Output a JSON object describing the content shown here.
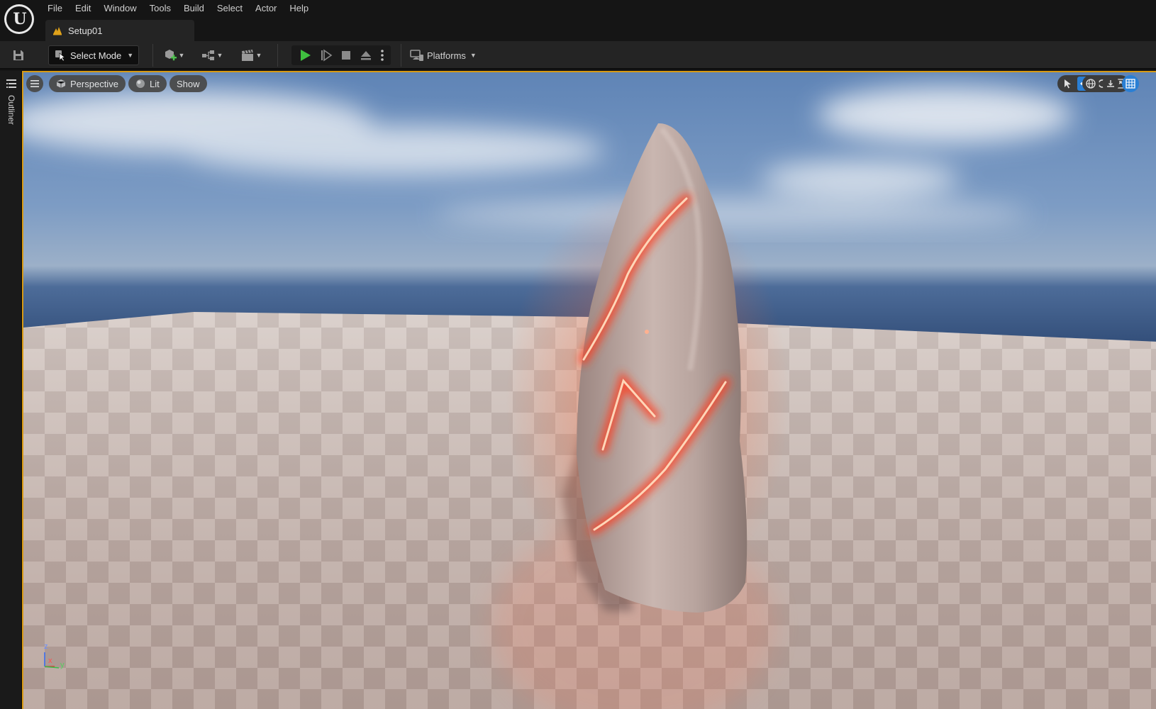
{
  "menu": [
    "File",
    "Edit",
    "Window",
    "Tools",
    "Build",
    "Select",
    "Actor",
    "Help"
  ],
  "document_tab": {
    "label": "Setup01",
    "icon": "level-icon"
  },
  "toolbar": {
    "save_icon": "save-icon",
    "mode_label": "Select Mode",
    "platforms_label": "Platforms",
    "play_color": "#3fbf3f"
  },
  "left_panel": {
    "label": "Outliner"
  },
  "viewport": {
    "perspective_label": "Perspective",
    "lit_label": "Lit",
    "show_label": "Show",
    "highlight_color": "#d89a13",
    "axis": {
      "z": "z",
      "x": "x",
      "y": "y"
    }
  },
  "colors": {
    "accent": "#2a7fd4",
    "glow": "#ff5a2c"
  }
}
